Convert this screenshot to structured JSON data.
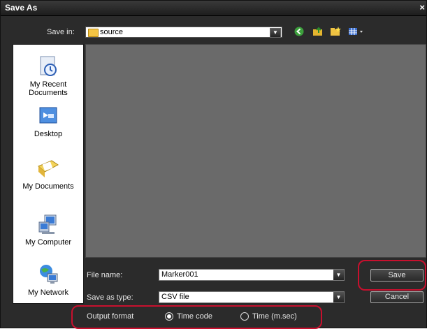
{
  "window": {
    "title": "Save As",
    "close_glyph": "×"
  },
  "toolbar": {
    "save_in_label": "Save in:",
    "save_in_value": "source",
    "back_icon": "back-arrow-icon",
    "up_icon": "up-folder-icon",
    "new_folder_icon": "new-folder-icon",
    "view_menu_icon": "view-menu-icon"
  },
  "places": [
    {
      "label": "My Recent\nDocuments",
      "icon": "recent-documents-icon"
    },
    {
      "label": "Desktop",
      "icon": "desktop-icon"
    },
    {
      "label": "My Documents",
      "icon": "my-documents-icon"
    },
    {
      "label": "My Computer",
      "icon": "my-computer-icon"
    },
    {
      "label": "My Network",
      "icon": "network-icon"
    }
  ],
  "form": {
    "file_name_label": "File name:",
    "file_name_value": "Marker001",
    "save_as_type_label": "Save as type:",
    "save_as_type_value": "CSV file",
    "save_button": "Save",
    "cancel_button": "Cancel"
  },
  "output": {
    "label": "Output format",
    "options": [
      {
        "label": "Time code",
        "selected": true
      },
      {
        "label": "Time (m.sec)",
        "selected": false
      }
    ]
  },
  "colors": {
    "highlight": "#c8102e",
    "background": "#2b2b2b"
  }
}
